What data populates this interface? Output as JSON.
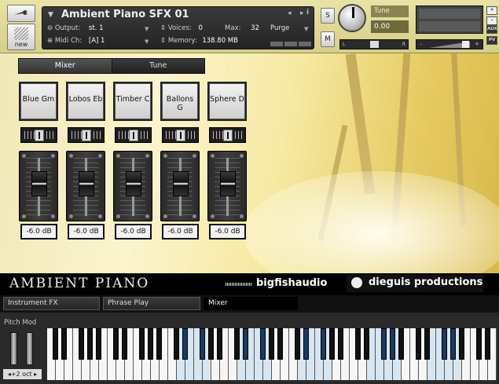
{
  "header": {
    "instrument_title": "Ambient Piano SFX 01",
    "output_label": "Output:",
    "output_value": "st. 1",
    "voices_label": "Voices:",
    "voices_value": "0",
    "max_label": "Max:",
    "max_value": "32",
    "purge_label": "Purge",
    "midi_label": "Midi Ch:",
    "midi_value": "[A] 1",
    "memory_label": "Memory:",
    "memory_value": "138.80 MB",
    "solo_label": "S",
    "mute_label": "M",
    "new_label": "new",
    "tune_label": "Tune",
    "tune_value": "0.00",
    "pan_left": "L",
    "pan_right": "R",
    "vol_minus": "–",
    "vol_plus": "+",
    "aux_label": "AUX",
    "pv_label": "PV",
    "nav_prev": "◂",
    "nav_next": "▸",
    "info_icon": "i"
  },
  "tabs": [
    {
      "label": "Mixer",
      "active": true
    },
    {
      "label": "Tune",
      "active": false
    }
  ],
  "channels": [
    {
      "name": "Blue Gm",
      "level": "-6.0 dB"
    },
    {
      "name": "Lobos Eb",
      "level": "-6.0 dB"
    },
    {
      "name": "Timber C",
      "level": "-6.0 dB"
    },
    {
      "name": "Ballons G",
      "level": "-6.0 dB"
    },
    {
      "name": "Sphere D",
      "level": "-6.0 dB"
    }
  ],
  "logos": {
    "product": "AMBIENT PIANO",
    "publisher": "bigfishaudio",
    "developer": "dieguis productions"
  },
  "bottom_tabs": [
    {
      "label": "Instrument FX",
      "active": false
    },
    {
      "label": "Phrase Play",
      "active": false
    },
    {
      "label": "Mixer",
      "active": true
    }
  ],
  "keyboard": {
    "pitch_mod_label": "Pitch Mod",
    "octave_label": "◂+2 oct ▸"
  },
  "colors": {
    "header_bg": "#e9e3a6",
    "key_highlight": "#d8e6f2",
    "black_key_highlight": "#1b3a5f"
  }
}
